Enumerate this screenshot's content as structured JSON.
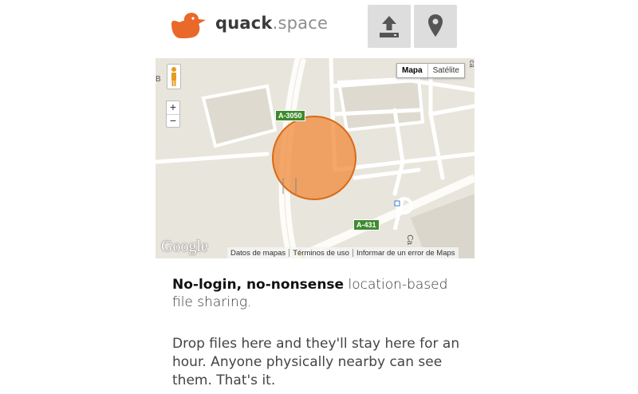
{
  "header": {
    "logo_icon": "duck-icon",
    "brand_name": "quack",
    "brand_suffix": ".space",
    "upload_icon": "upload-icon",
    "location_icon": "location-pin-icon",
    "accent_color": "#e8692a"
  },
  "map": {
    "type_buttons": [
      "Mapa",
      "Satélite"
    ],
    "active_type": "Mapa",
    "zoom_in": "+",
    "zoom_out": "−",
    "road_signs": [
      "A-3050",
      "A-431"
    ],
    "edge_labels": [
      "B",
      "Ca",
      "ca"
    ],
    "attribution": {
      "logo": "Google",
      "links": [
        "Datos de mapas",
        "Términos de uso",
        "Informar de un error de Maps"
      ]
    },
    "radius_color": "#f08a3a"
  },
  "content": {
    "tagline_bold": "No-login, no-nonsense",
    "tagline_rest": " location-based file sharing.",
    "description": "Drop files here and they'll stay here for an hour. Anyone physically nearby can see them. That's it."
  }
}
